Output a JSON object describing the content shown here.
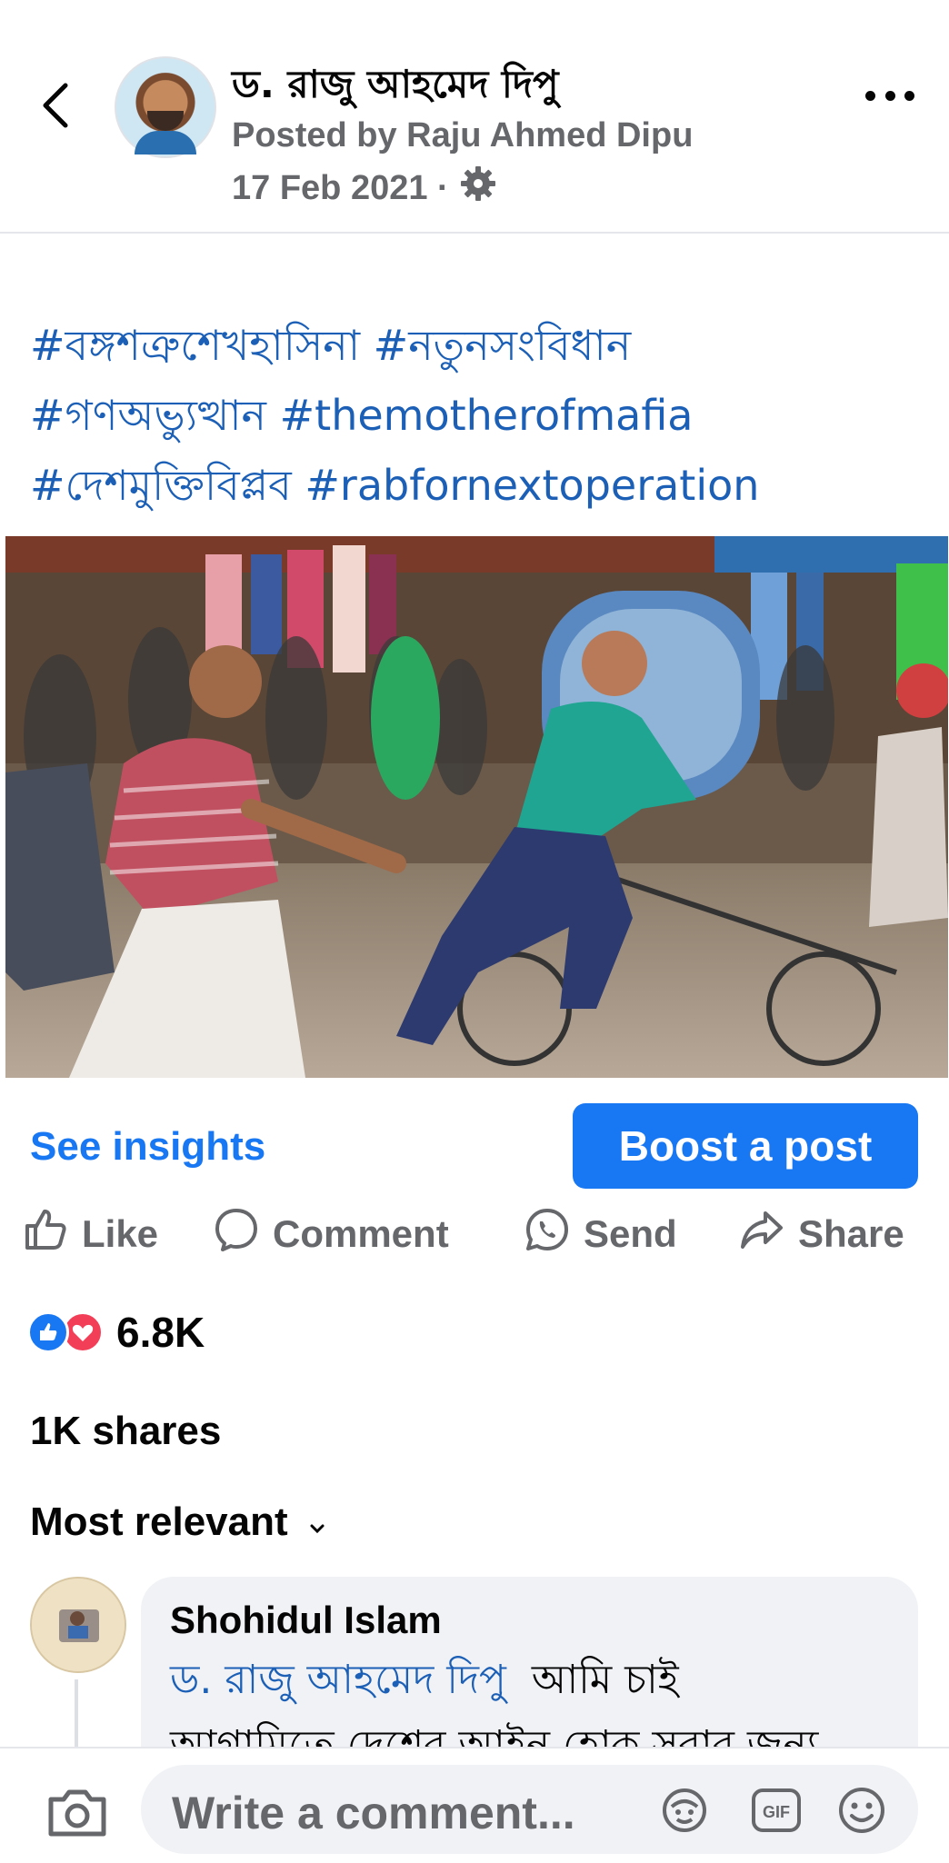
{
  "header": {
    "page_name": "ড. রাজু আহমেদ দিপু",
    "posted_by": "Posted by Raju Ahmed Dipu",
    "date": "17 Feb 2021 ·"
  },
  "post": {
    "hashtags": [
      "#বঙ্গশত্রুশেখহাসিনা #নতুনসংবিধান",
      "#গণঅভ্যুত্থান #themotherofmafia",
      "#দেশমুক্তিবিপ্লব #rabfornextoperation"
    ]
  },
  "insights": {
    "see_insights": "See insights",
    "boost": "Boost a post"
  },
  "actions": {
    "like": "Like",
    "comment": "Comment",
    "send": "Send",
    "share": "Share"
  },
  "stats": {
    "reaction_count": "6.8K",
    "shares": "1K shares"
  },
  "comments": {
    "sort_label": "Most relevant",
    "first": {
      "author": "Shohidul Islam",
      "mention": "ড. রাজু আহমেদ দিপু",
      "text": "আমি চাই",
      "text_line2": "আগামিতে দেশের আইন হোক সবার জন্য"
    }
  },
  "composer": {
    "placeholder": "Write a comment..."
  },
  "colors": {
    "accent": "#1877f2",
    "hashtag": "#1b5fb6",
    "muted": "#65676b",
    "bubble": "#f0f2f5"
  },
  "icons": [
    "back-icon",
    "more-icon",
    "gear-icon",
    "like-icon",
    "comment-icon",
    "whatsapp-icon",
    "share-icon",
    "chevron-down-icon",
    "camera-icon",
    "avatar-sticker-icon",
    "gif-icon",
    "emoji-icon"
  ]
}
